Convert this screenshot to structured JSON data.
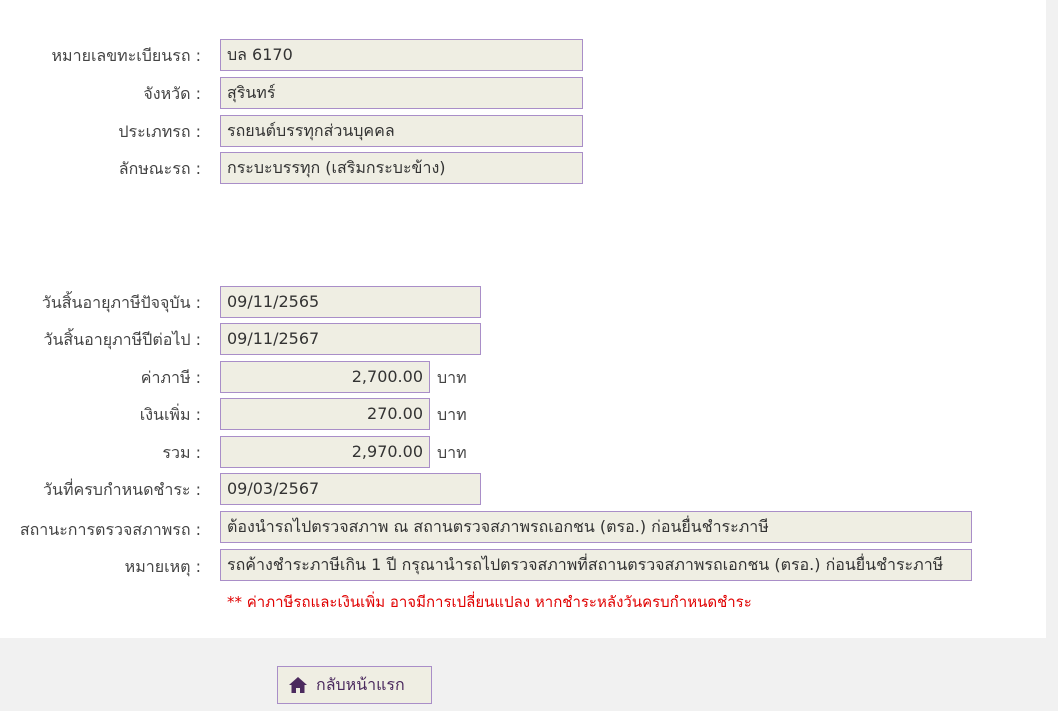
{
  "vehicle": {
    "plate_label": "หมายเลขทะเบียนรถ :",
    "plate_value": "บล 6170",
    "province_label": "จังหวัด :",
    "province_value": "สุรินทร์",
    "type_label": "ประเภทรถ :",
    "type_value": "รถยนต์บรรทุกส่วนบุคคล",
    "style_label": "ลักษณะรถ :",
    "style_value": "กระบะบรรทุก (เสริมกระบะข้าง)"
  },
  "tax": {
    "current_expiry_label": "วันสิ้นอายุภาษีปัจจุบัน :",
    "current_expiry_value": "09/11/2565",
    "next_expiry_label": "วันสิ้นอายุภาษีปีต่อไป :",
    "next_expiry_value": "09/11/2567",
    "tax_label": "ค่าภาษี :",
    "tax_value": "2,700.00",
    "surcharge_label": "เงินเพิ่ม :",
    "surcharge_value": "270.00",
    "total_label": "รวม :",
    "total_value": "2,970.00",
    "currency": "บาท",
    "due_date_label": "วันที่ครบกำหนดชำระ :",
    "due_date_value": "09/03/2567",
    "inspection_label": "สถานะการตรวจสภาพรถ :",
    "inspection_value": "ต้องนำรถไปตรวจสภาพ ณ สถานตรวจสภาพรถเอกชน (ตรอ.) ก่อนยื่นชำระภาษี",
    "remark_label": "หมายเหตุ :",
    "remark_value": "รถค้างชำระภาษีเกิน 1 ปี กรุณานำรถไปตรวจสภาพที่สถานตรวจสภาพรถเอกชน (ตรอ.) ก่อนยื่นชำระภาษี",
    "warning_note": "** ค่าภาษีรถและเงินเพิ่ม อาจมีการเปลี่ยนแปลง หากชำระหลังวันครบกำหนดชำระ"
  },
  "actions": {
    "back_label": "กลับหน้าแรก",
    "back_icon": "home-icon",
    "accent_color": "#4b2a5e",
    "field_border_color": "#a98ec8",
    "field_bg_color": "#efeee3",
    "warning_color": "#e00000"
  }
}
